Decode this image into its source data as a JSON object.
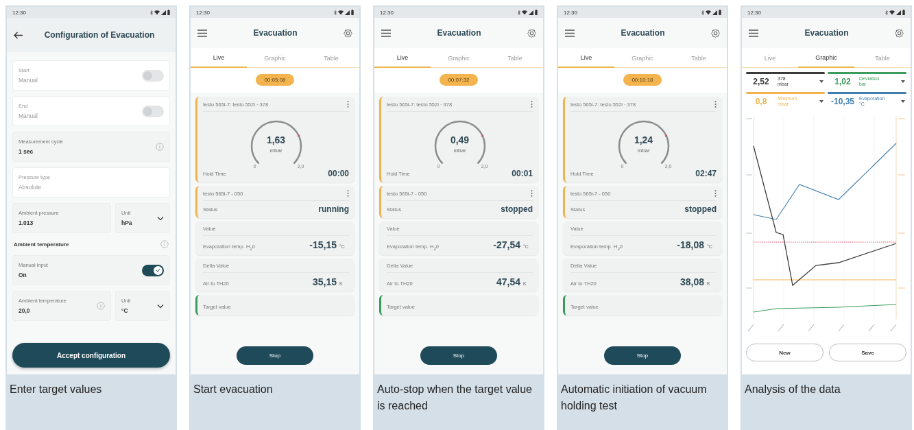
{
  "panels": [
    {
      "kind": "config",
      "caption": "Enter target values",
      "time": "12:30",
      "title": "Configuration of Evacuation",
      "fields": [
        {
          "kind": "toggle",
          "label": "Start",
          "value": "Manual",
          "on": false,
          "disabled": true
        },
        {
          "kind": "toggle",
          "label": "End",
          "value": "Manual",
          "on": false,
          "disabled": true
        },
        {
          "kind": "info",
          "label": "Measurement cycle",
          "value": "1 sec",
          "disabled": false
        },
        {
          "kind": "text",
          "label": "Pressure type",
          "value": "Absolute",
          "disabled": true
        },
        {
          "kind": "pair",
          "label": "Ambient pressure",
          "value": "1.013",
          "info": false,
          "unit_label": "Unit",
          "unit": "hPa"
        },
        {
          "kind": "heading",
          "text": "Ambient temperature"
        },
        {
          "kind": "toggle",
          "label": "Manual input",
          "value": "On",
          "on": true,
          "disabled": false
        },
        {
          "kind": "pair",
          "label": "Ambient temperature",
          "value": "20,0",
          "info": true,
          "unit_label": "Unit",
          "unit": "°C"
        }
      ],
      "button": "Accept configuration"
    },
    {
      "kind": "live",
      "caption": "Start evacuation",
      "time": "12:30",
      "title": "Evacuation",
      "tabs": [
        {
          "label": "Live",
          "selected": true
        },
        {
          "label": "Graphic",
          "selected": false
        },
        {
          "label": "Table",
          "selected": false
        }
      ],
      "timer": "00:05:08",
      "cards": [
        {
          "kind": "gauge",
          "color": "#f0b44c",
          "device": "testo 565i-7: testo 552i · 378",
          "value": "1,63",
          "unit": "mbar",
          "min": "0",
          "max": "2,0",
          "label": "Hold Time",
          "reading": "00:00"
        },
        {
          "kind": "status",
          "color": "#f0b44c",
          "device": "testo 565i-7 - 050",
          "label": "Status",
          "reading": "running"
        },
        {
          "kind": "value",
          "title": "Value",
          "label": "Evaporation temp. H$_{2}$0",
          "reading": "-15,15",
          "unit": "°C"
        },
        {
          "kind": "value",
          "title": "Delta Value",
          "label": "Air to TH20",
          "reading": "35,15",
          "unit": "K"
        },
        {
          "kind": "target",
          "color": "#3a9b5c",
          "title": "Target value"
        }
      ],
      "button": "Stop"
    },
    {
      "kind": "live",
      "caption": "Auto-stop when the target value is reached",
      "time": "12:30",
      "title": "Evacuation",
      "tabs": [
        {
          "label": "Live",
          "selected": true
        },
        {
          "label": "Graphic",
          "selected": false
        },
        {
          "label": "Table",
          "selected": false
        }
      ],
      "timer": "00:07:32",
      "cards": [
        {
          "kind": "gauge",
          "color": "#f0b44c",
          "device": "testo 565i-7: testo 552i · 378",
          "value": "0,49",
          "unit": "mbar",
          "min": "0",
          "max": "2,0",
          "label": "Hold Time",
          "reading": "00:01"
        },
        {
          "kind": "status",
          "color": "#f0b44c",
          "device": "testo 565i-7 - 050",
          "label": "Status",
          "reading": "stopped"
        },
        {
          "kind": "value",
          "title": "Value",
          "label": "Evaporation temp. H$_{2}$0",
          "reading": "-27,54",
          "unit": "°C"
        },
        {
          "kind": "value",
          "title": "Delta Value",
          "label": "Air to TH20",
          "reading": "47,54",
          "unit": "K"
        },
        {
          "kind": "target",
          "color": "#3a9b5c",
          "title": "Target value"
        }
      ],
      "button": "Stop"
    },
    {
      "kind": "live",
      "caption": "Automatic initiation of vacuum holding test",
      "time": "12:30",
      "title": "Evacuation",
      "tabs": [
        {
          "label": "Live",
          "selected": true
        },
        {
          "label": "Graphic",
          "selected": false
        },
        {
          "label": "Table",
          "selected": false
        }
      ],
      "timer": "00:10:18",
      "cards": [
        {
          "kind": "gauge",
          "color": "#f0b44c",
          "device": "testo 565i-7: testo 552i · 378",
          "value": "1,24",
          "unit": "mbar",
          "min": "0",
          "max": "2,0",
          "label": "Hold Time",
          "reading": "02:47"
        },
        {
          "kind": "status",
          "color": "#f0b44c",
          "device": "testo 565i-7 - 050",
          "label": "Status",
          "reading": "stopped"
        },
        {
          "kind": "value",
          "title": "Value",
          "label": "Evaporation temp. H$_{2}$0",
          "reading": "-18,08",
          "unit": "°C"
        },
        {
          "kind": "value",
          "title": "Delta Value",
          "label": "Air to TH20",
          "reading": "38,08",
          "unit": "K"
        },
        {
          "kind": "target",
          "color": "#3a9b5c",
          "title": "Target value"
        }
      ],
      "button": "Stop"
    },
    {
      "kind": "graphic",
      "caption": "Analysis of the data",
      "time": "12:30",
      "title": "Evacuation",
      "tabs": [
        {
          "label": "Live",
          "selected": false
        },
        {
          "label": "Graphic",
          "selected": true
        },
        {
          "label": "Table",
          "selected": false
        }
      ],
      "legend": [
        {
          "value": "2,52",
          "name": "378",
          "unit": "mbar",
          "color": "#3a3a3a"
        },
        {
          "value": "1,02",
          "name": "Deviation",
          "unit": "bar",
          "color": "#3a9b5c"
        },
        {
          "value": "0,8",
          "name": "Minimum",
          "unit": "mbar",
          "color": "#f0b44c"
        },
        {
          "value": "-10,35",
          "name": "Evaporation",
          "unit": "°C",
          "color": "#3f7fb0"
        }
      ],
      "buttons": [
        "New",
        "Save"
      ]
    }
  ]
}
